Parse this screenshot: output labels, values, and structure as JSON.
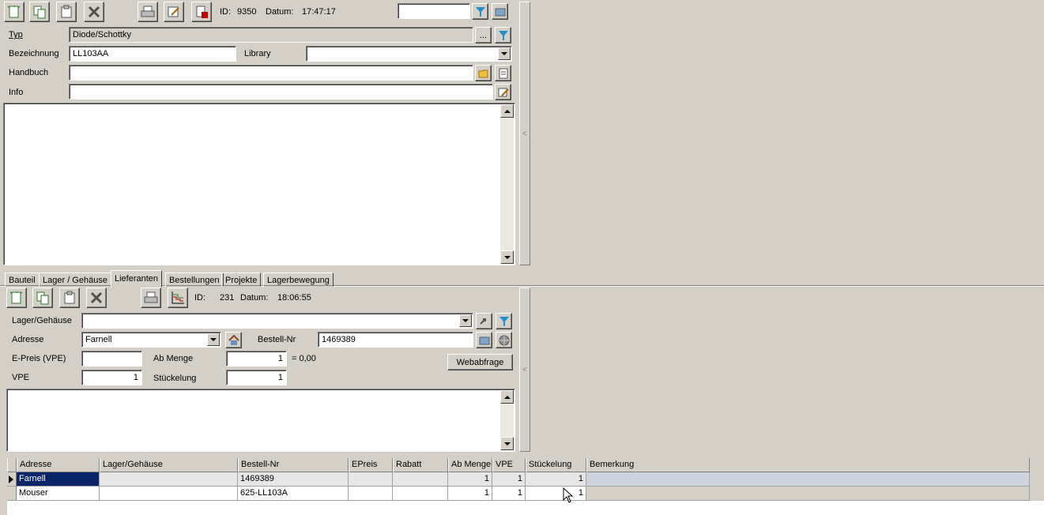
{
  "top": {
    "toolbar": {
      "id_label": "ID:",
      "id_value": "9350",
      "datum_label": "Datum:",
      "datum_value": "17:47:17",
      "filter_value": ""
    },
    "fields": {
      "typ_label": "Typ",
      "typ_value": "Diode/Schottky",
      "typ_button": "...",
      "bezeichnung_label": "Bezeichnung",
      "bezeichnung_value": "LL103AA",
      "library_label": "Library",
      "library_value": "",
      "handbuch_label": "Handbuch",
      "handbuch_value": "",
      "info_label": "Info",
      "info_value": ""
    },
    "memo": ""
  },
  "tabs": [
    {
      "label": "Bauteil"
    },
    {
      "label": "Lager / Gehäuse"
    },
    {
      "label": "Lieferanten"
    },
    {
      "label": "Bestellungen"
    },
    {
      "label": "Projekte"
    },
    {
      "label": "Lagerbewegung"
    }
  ],
  "active_tab": "Lieferanten",
  "bottom": {
    "toolbar": {
      "id_label": "ID:",
      "id_value": "231",
      "datum_label": "Datum:",
      "datum_value": "18:06:55"
    },
    "fields": {
      "lager_label": "Lager/Gehäuse",
      "lager_value": "",
      "adresse_label": "Adresse",
      "adresse_value": "Farnell",
      "bestellnr_label": "Bestell-Nr",
      "bestellnr_value": "1469389",
      "epreis_label": "E-Preis (VPE)",
      "epreis_value": "",
      "abmenge_label": "Ab Menge",
      "abmenge_value": "1",
      "sum_text": "= 0,00",
      "vpe_label": "VPE",
      "vpe_value": "1",
      "stueckelung_label": "Stückelung",
      "stueckelung_value": "1",
      "webabfrage_label": "Webabfrage"
    },
    "memo": ""
  },
  "grid": {
    "columns": [
      "Adresse",
      "Lager/Gehäuse",
      "Bestell-Nr",
      "EPreis",
      "Rabatt",
      "Ab Menge",
      "VPE",
      "Stückelung",
      "Bemerkung"
    ],
    "rows": [
      {
        "adresse": "Farnell",
        "lager": "",
        "bestellnr": "1469389",
        "epreis": "",
        "rabatt": "",
        "abmenge": "1",
        "vpe": "1",
        "stueckelung": "1",
        "bemerkung": ""
      },
      {
        "adresse": "Mouser",
        "lager": "",
        "bestellnr": "625-LL103A",
        "epreis": "",
        "rabatt": "",
        "abmenge": "1",
        "vpe": "1",
        "stueckelung": "1",
        "bemerkung": ""
      }
    ]
  },
  "splitter_glyph": "<",
  "colors": {
    "background": "#d4d0c8",
    "selection": "#0a246a",
    "filter_icon": "#1f8fd0"
  }
}
